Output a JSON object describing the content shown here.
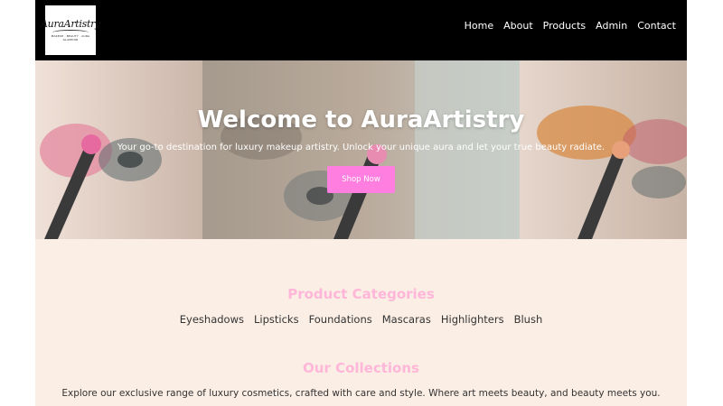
{
  "logo": {
    "script": "AuraArtistry",
    "tagline": "MAKEUP · BEAUTY · AURA",
    "subtag": "GLAMOUR"
  },
  "nav": {
    "items": [
      "Home",
      "About",
      "Products",
      "Admin",
      "Contact"
    ]
  },
  "hero": {
    "title": "Welcome to AuraArtistry",
    "subtitle": "Your go-to destination for luxury makeup artistry. Unlock your unique aura and let your true beauty radiate.",
    "button": "Shop Now"
  },
  "categories": {
    "title": "Product Categories",
    "items": [
      "Eyeshadows",
      "Lipsticks",
      "Foundations",
      "Mascaras",
      "Highlighters",
      "Blush"
    ]
  },
  "collections": {
    "title": "Our Collections",
    "text": "Explore our exclusive range of luxury cosmetics, crafted with care and style. Where art meets beauty, and beauty meets you."
  },
  "colors": {
    "header": "#000000",
    "page": "#fbeee5",
    "accent_button": "#ff7ee0",
    "section_title": "#ffb6d9"
  }
}
